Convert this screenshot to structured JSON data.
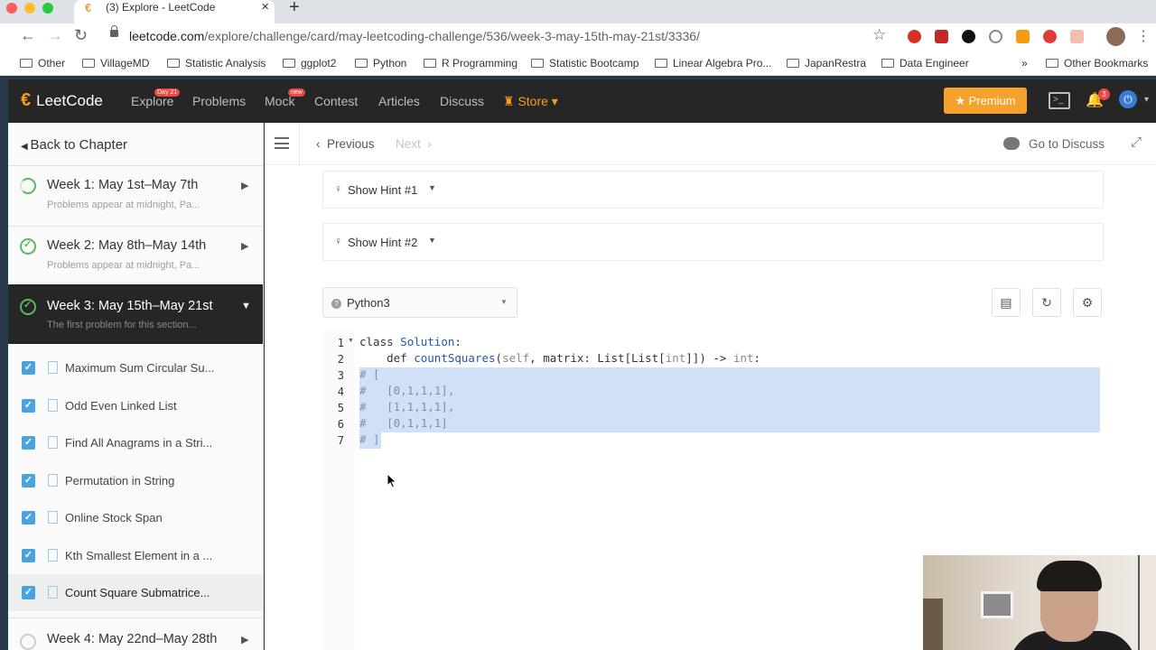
{
  "browser": {
    "tab_title": "(3) Explore - LeetCode",
    "url_host": "leetcode.com",
    "url_path": "/explore/challenge/card/may-leetcoding-challenge/536/week-3-may-15th-may-21st/3336/",
    "bookmarks": [
      "Other",
      "VillageMD",
      "Statistic Analysis",
      "ggplot2",
      "Python",
      "R Programming",
      "Statistic Bootcamp",
      "Linear Algebra Pro...",
      "JapanRestra",
      "Data Engineer",
      "»",
      "Other Bookmarks"
    ]
  },
  "nav": {
    "logo": "LeetCode",
    "explore": "Explore",
    "explore_badge": "Day 21",
    "problems": "Problems",
    "mock": "Mock",
    "mock_badge": "new",
    "contest": "Contest",
    "articles": "Articles",
    "discuss": "Discuss",
    "store": "Store",
    "premium": "Premium",
    "notifications": "3"
  },
  "sidebar": {
    "back": "Back to Chapter",
    "weeks": [
      {
        "title": "Week 1: May 1st–May 7th",
        "sub": "Problems appear at midnight, Pa..."
      },
      {
        "title": "Week 2: May 8th–May 14th",
        "sub": "Problems appear at midnight, Pa..."
      },
      {
        "title": "Week 3: May 15th–May 21st",
        "sub": "The first problem for this section..."
      },
      {
        "title": "Week 4: May 22nd–May 28th",
        "sub": ""
      }
    ],
    "problems": [
      "Maximum Sum Circular Su...",
      "Odd Even Linked List",
      "Find All Anagrams in a Stri...",
      "Permutation in String",
      "Online Stock Span",
      "Kth Smallest Element in a ...",
      "Count Square Submatrice..."
    ]
  },
  "toolbar": {
    "previous": "Previous",
    "next": "Next",
    "goto_discuss": "Go to Discuss"
  },
  "hints": [
    "Show Hint #1",
    "Show Hint #2"
  ],
  "editor": {
    "language": "Python3",
    "line_numbers": [
      "1",
      "2",
      "3",
      "4",
      "5",
      "6",
      "7"
    ]
  }
}
